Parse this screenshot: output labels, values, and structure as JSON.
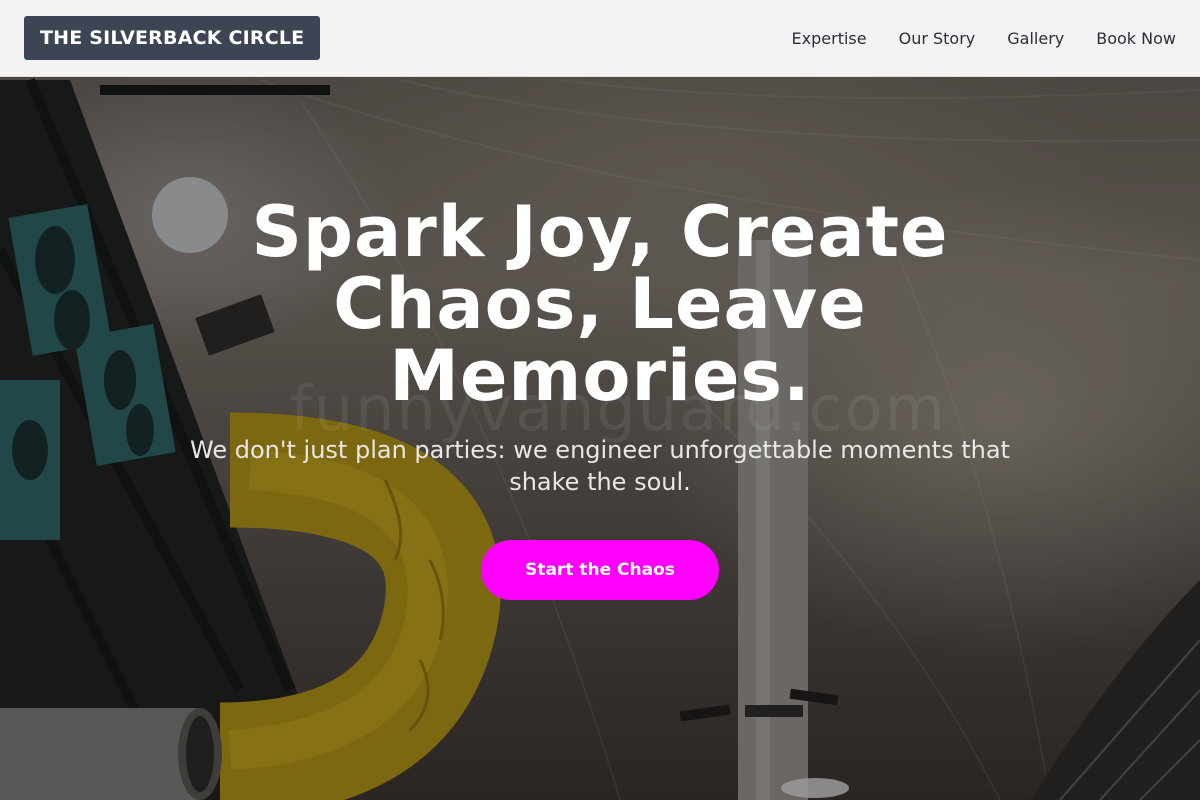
{
  "nav": {
    "brand": "THE SILVERBACK CIRCLE",
    "links": [
      "Expertise",
      "Our Story",
      "Gallery",
      "Book Now"
    ]
  },
  "hero": {
    "headline": "Spark Joy, Create Chaos, Leave Memories.",
    "subheadline": "We don't just plan parties: we engineer unforgettable moments that shake the soul.",
    "cta_label": "Start the Chaos",
    "background_image": "indoor-playground-tent-photo",
    "watermark": "funnyvanguard.com"
  },
  "colors": {
    "navbar_bg": "#f3f3f3",
    "brand_bg": "#3d4454",
    "cta_bg": "#ff00ff",
    "headline": "#ffffff"
  }
}
